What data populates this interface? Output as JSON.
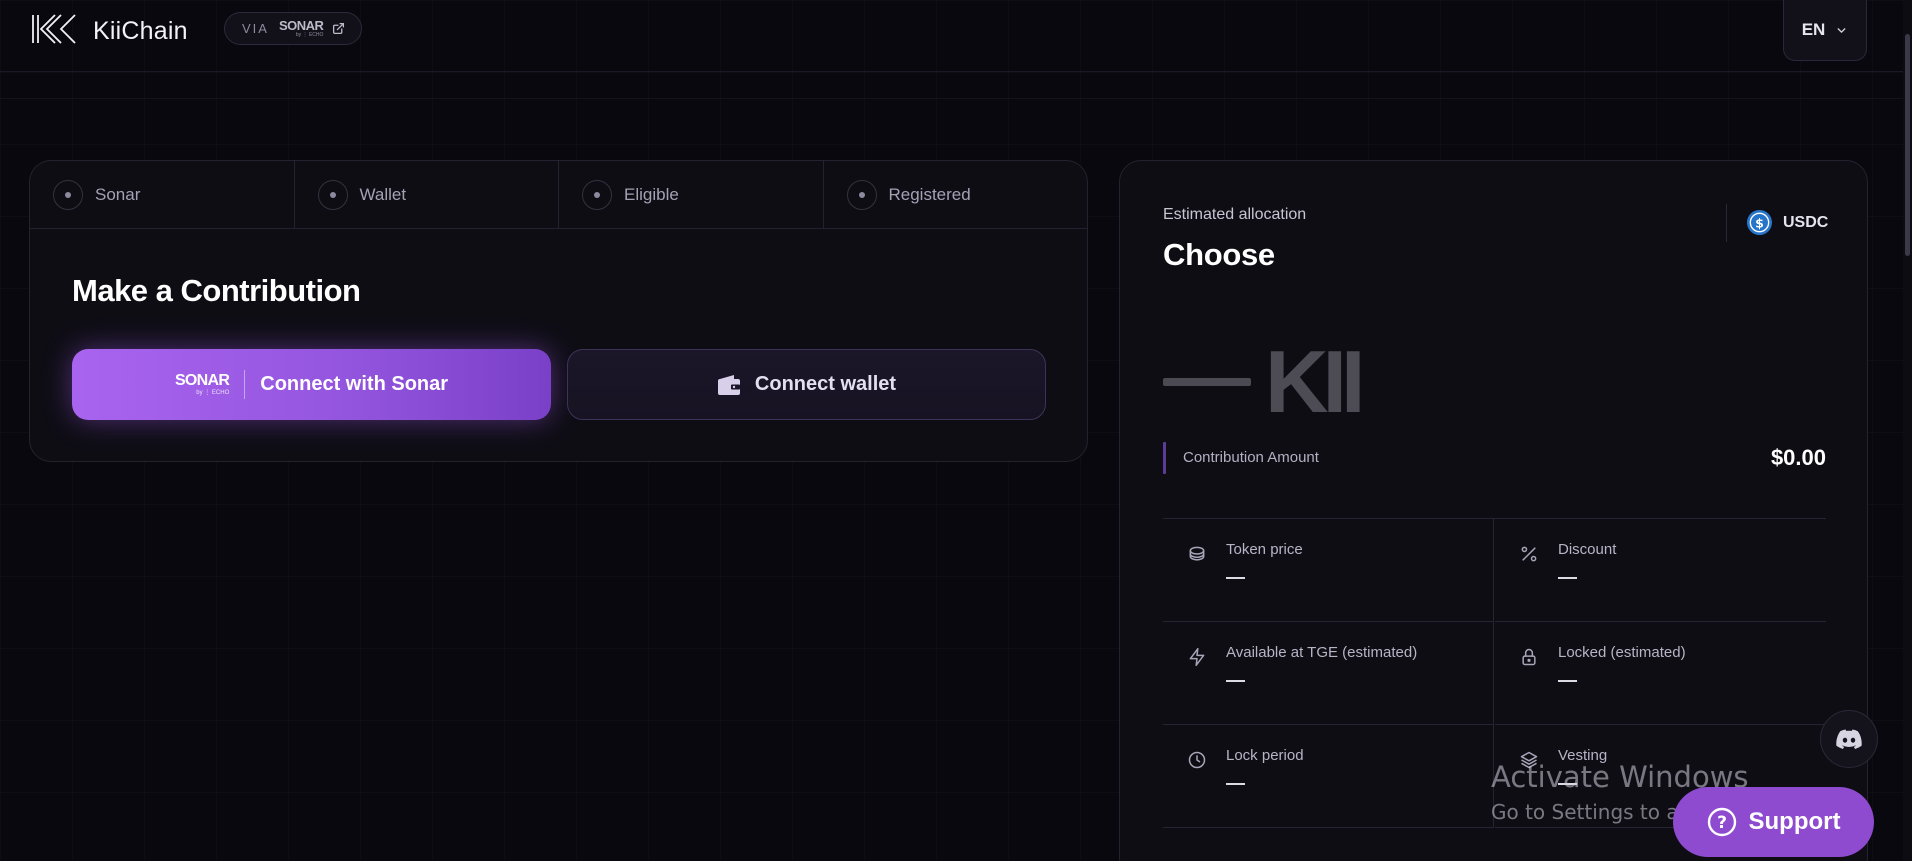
{
  "header": {
    "brand": "KiiChain",
    "via_label": "VIA",
    "via_partner": "SONAR",
    "via_partner_sub": "by ⋮ ECHO",
    "language": "EN"
  },
  "steps": [
    {
      "label": "Sonar"
    },
    {
      "label": "Wallet"
    },
    {
      "label": "Eligible"
    },
    {
      "label": "Registered"
    }
  ],
  "contribution": {
    "title": "Make a Contribution",
    "sonar_logo": "SONAR",
    "sonar_logo_sub": "by ⋮ ECHO",
    "connect_sonar_label": "Connect with Sonar",
    "connect_wallet_label": "Connect wallet"
  },
  "allocation": {
    "label": "Estimated allocation",
    "value": "Choose",
    "currency": "USDC",
    "token_symbol": "KII",
    "contribution_label": "Contribution Amount",
    "contribution_value": "$0.00",
    "stats": [
      {
        "label": "Token price",
        "value": "—",
        "icon": "coins-icon"
      },
      {
        "label": "Discount",
        "value": "—",
        "icon": "percent-icon"
      },
      {
        "label": "Available at TGE (estimated)",
        "value": "—",
        "icon": "lightning-icon"
      },
      {
        "label": "Locked (estimated)",
        "value": "—",
        "icon": "lock-icon"
      },
      {
        "label": "Lock period",
        "value": "—",
        "icon": "clock-icon"
      },
      {
        "label": "Vesting",
        "value": "—",
        "icon": "layers-icon"
      }
    ]
  },
  "support": {
    "label": "Support"
  },
  "watermark": {
    "line1": "Activate Windows",
    "line2": "Go to Settings to activate Windows."
  },
  "colors": {
    "background": "#09080e",
    "card": "#0e0d14",
    "accent_purple": "#9556df",
    "support_purple": "#8e4bcf",
    "usdc_blue": "#2775ca"
  }
}
